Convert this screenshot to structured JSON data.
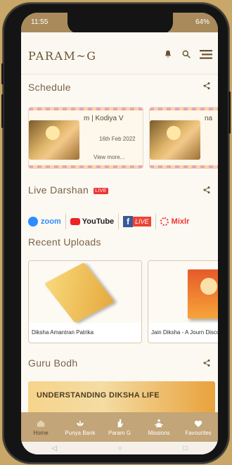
{
  "status": {
    "time": "11:55",
    "battery": "64%"
  },
  "header": {
    "logo": "PARAM~G",
    "icons": [
      "bell-icon",
      "search-icon",
      "menu-icon"
    ]
  },
  "sections": {
    "schedule": {
      "title": "Schedule",
      "cards": [
        {
          "title": "m | Kodiya V",
          "date": "16th Feb 2022",
          "more": "View more..."
        },
        {
          "title": "na",
          "date": "",
          "more": ""
        }
      ]
    },
    "live": {
      "title": "Live Darshan",
      "badge": "LIVE",
      "platforms": [
        "zoom",
        "YouTube",
        "LIVE",
        "Mixlr"
      ]
    },
    "uploads": {
      "title": "Recent Uploads",
      "cards": [
        {
          "label": "Diksha Amantran Patrika"
        },
        {
          "label": "Jain Diksha - A Journ Discovery"
        }
      ]
    },
    "guru": {
      "title": "Guru Bodh",
      "banner": "UNDERSTANDING DIKSHA LIFE"
    }
  },
  "bottom_nav": [
    "Home",
    "Punya Bank",
    "Param G",
    "Missions",
    "Favourites"
  ],
  "colors": {
    "accent": "#c2a578",
    "text": "#7a6244",
    "background": "#fcf9f3"
  }
}
